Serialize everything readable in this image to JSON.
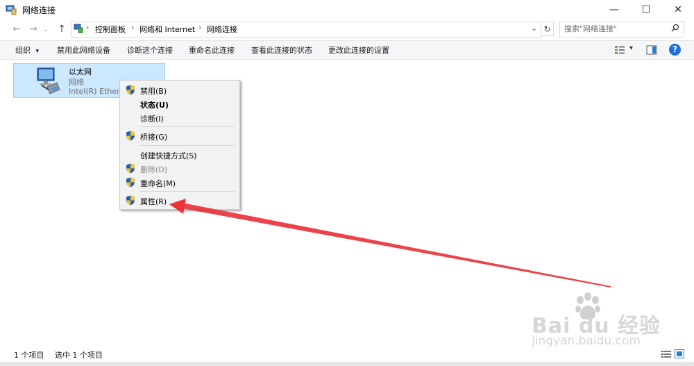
{
  "window": {
    "title": "网络连接",
    "controls": {
      "minimize": "—",
      "maximize": "☐",
      "close": "✕"
    }
  },
  "nav": {
    "back": "←",
    "forward": "→",
    "recent": "⌄",
    "up": "↑"
  },
  "address": {
    "segments": [
      "控制面板",
      "网络和 Internet",
      "网络连接"
    ],
    "separator": "›",
    "dropdown": "⌄",
    "refresh": "↻"
  },
  "search": {
    "placeholder": "搜索\"网络连接\""
  },
  "toolbar": {
    "items": [
      "组织",
      "禁用此网络设备",
      "诊断这个连接",
      "重命名此连接",
      "查看此连接的状态",
      "更改此连接的设置"
    ],
    "organize_arrow": "▾",
    "view_arrow": "▾",
    "help": "?"
  },
  "items": [
    {
      "name": "以太网",
      "status": "网络",
      "device": "Intel(R) Ethern"
    }
  ],
  "context_menu": {
    "items": [
      {
        "label": "禁用(B)",
        "shield": true,
        "bold": false,
        "disabled": false
      },
      {
        "label": "状态(U)",
        "shield": false,
        "bold": true,
        "disabled": false
      },
      {
        "label": "诊断(I)",
        "shield": false,
        "bold": false,
        "disabled": false
      },
      {
        "label": "桥接(G)",
        "shield": true,
        "bold": false,
        "disabled": false
      },
      {
        "label": "创建快捷方式(S)",
        "shield": false,
        "bold": false,
        "disabled": false
      },
      {
        "label": "删除(D)",
        "shield": true,
        "bold": false,
        "disabled": true
      },
      {
        "label": "重命名(M)",
        "shield": true,
        "bold": false,
        "disabled": false
      },
      {
        "label": "属性(R)",
        "shield": true,
        "bold": false,
        "disabled": false
      }
    ]
  },
  "status_bar": {
    "count": "1 个项目",
    "selected": "选中 1 个项目"
  },
  "watermark": {
    "brand": "Bai du 经验",
    "url": "jingyan.baidu.com"
  },
  "colors": {
    "selection_bg": "#cce8ff",
    "selection_border": "#99d1ff",
    "annotation_arrow": "#e8333a",
    "help_blue": "#1e6fd9"
  }
}
